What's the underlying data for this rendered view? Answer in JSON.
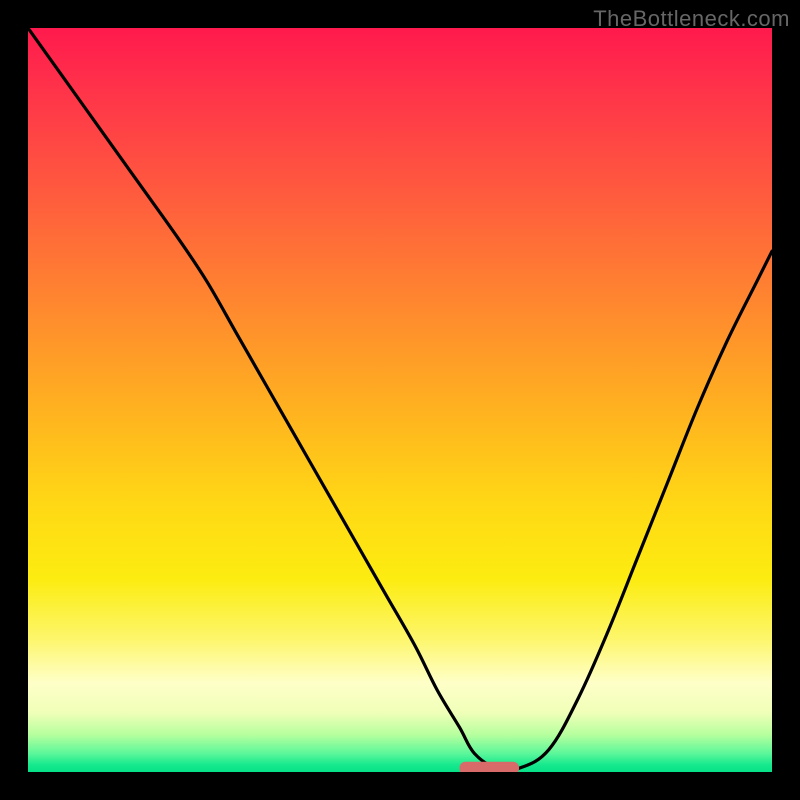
{
  "watermark": "TheBottleneck.com",
  "colors": {
    "frame": "#000000",
    "curve": "#000000",
    "marker": "#d86a6a",
    "gradient_top": "#ff1a4d",
    "gradient_mid": "#ffd815",
    "gradient_bottom": "#05e188"
  },
  "chart_data": {
    "type": "line",
    "title": "",
    "xlabel": "",
    "ylabel": "",
    "xlim": [
      0,
      100
    ],
    "ylim": [
      0,
      100
    ],
    "series": [
      {
        "name": "bottleneck-curve",
        "x": [
          0,
          5,
          10,
          15,
          20,
          24,
          28,
          32,
          36,
          40,
          44,
          48,
          52,
          55,
          58,
          60,
          63,
          66,
          70,
          74,
          78,
          82,
          86,
          90,
          94,
          98,
          100
        ],
        "values": [
          100,
          93,
          86,
          79,
          72,
          66,
          59,
          52,
          45,
          38,
          31,
          24,
          17,
          11,
          6,
          2.5,
          0.5,
          0.5,
          3,
          10,
          19,
          29,
          39,
          49,
          58,
          66,
          70
        ]
      }
    ],
    "annotations": [
      {
        "name": "optimum-marker",
        "x_center": 62,
        "y": 0.5,
        "width_pct": 8
      }
    ],
    "grid": false,
    "legend": false
  }
}
